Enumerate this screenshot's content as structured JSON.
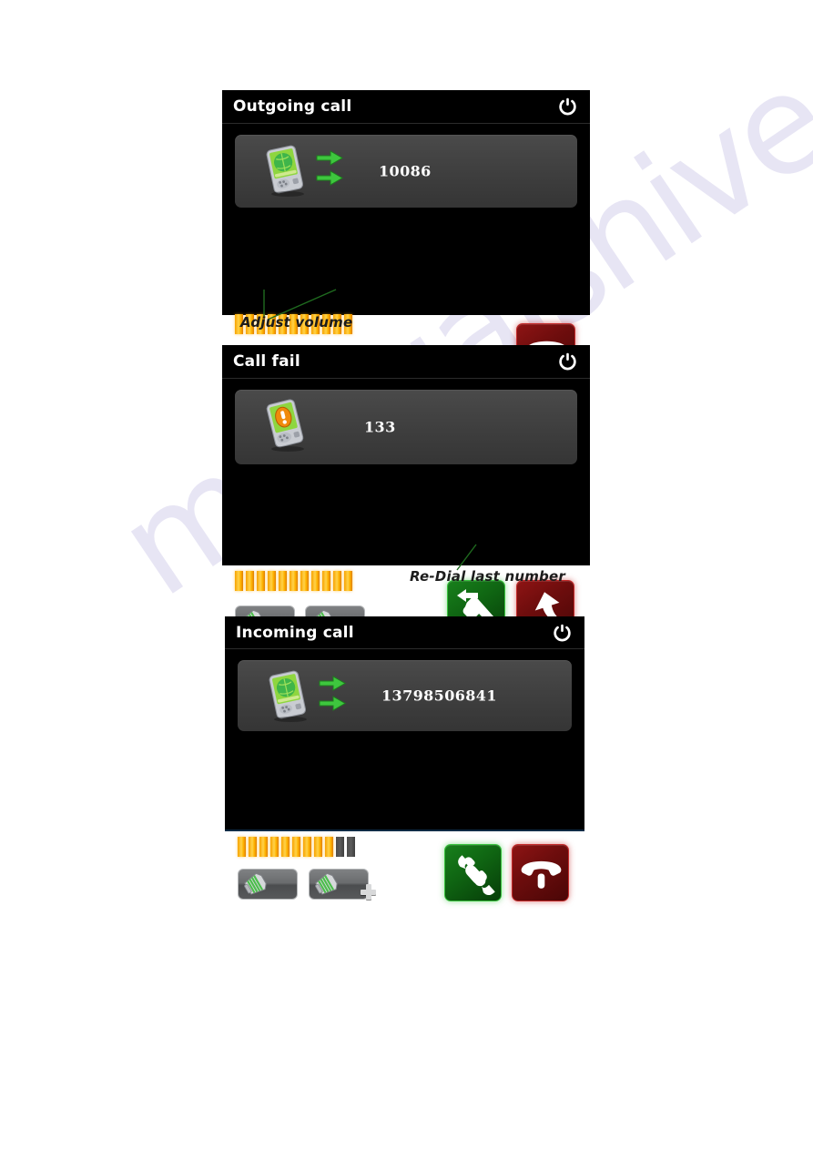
{
  "watermark": {
    "text": "manualshive.com"
  },
  "panels": [
    {
      "id": "outgoing-call",
      "title": "Outgoing call",
      "power_icon": "power-icon",
      "device_icon": "pda-globe-icon",
      "transfer_icon": "double-green-arrow-icon",
      "number": "10086",
      "volume": {
        "total": 11,
        "filled": 11
      },
      "buttons": {
        "volume_down": "volume-down-button",
        "volume_up": "volume-up-button",
        "hangup": "hangup-button"
      }
    },
    {
      "id": "call-fail",
      "title": "Call fail",
      "power_icon": "power-icon",
      "device_icon": "pda-warning-icon",
      "number": "133",
      "volume": {
        "total": 11,
        "filled": 11
      },
      "buttons": {
        "volume_down": "volume-down-button",
        "volume_up": "volume-up-button",
        "redial": "redial-button",
        "back": "back-button"
      }
    },
    {
      "id": "incoming-call",
      "title": "Incoming call",
      "power_icon": "power-icon",
      "device_icon": "pda-globe-icon",
      "transfer_icon": "double-green-arrow-icon",
      "number": "13798506841",
      "volume": {
        "total": 11,
        "filled": 9
      },
      "buttons": {
        "volume_down": "volume-down-button",
        "volume_up": "volume-up-button",
        "answer": "answer-button",
        "hangup": "hangup-button"
      }
    }
  ],
  "annotations": {
    "adjust_volume": "Adjust volume",
    "redial_last_number": "Re-Dial last number"
  },
  "colors": {
    "panel_bg": "#000000",
    "numberbox_bg": "#3e3e3e",
    "volume_on": "#ffb300",
    "volume_off": "#4c4c4c",
    "green_button": "#0f6412",
    "red_button": "#6e0d0d",
    "annotation_leader": "#1f6b1f",
    "title_text": "#ffffff"
  }
}
